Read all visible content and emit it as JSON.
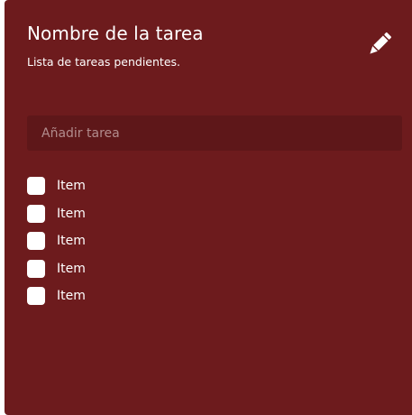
{
  "card": {
    "title": "Nombre de la tarea",
    "subtitle": "Lista de tareas pendientes.",
    "background": "#6d1b1d",
    "edit_icon": "pencil-icon"
  },
  "input": {
    "placeholder": "Añadir tarea",
    "value": ""
  },
  "items": [
    {
      "label": "Item",
      "checked": false
    },
    {
      "label": "Item",
      "checked": false
    },
    {
      "label": "Item",
      "checked": false
    },
    {
      "label": "Item",
      "checked": false
    },
    {
      "label": "Item",
      "checked": false
    }
  ]
}
